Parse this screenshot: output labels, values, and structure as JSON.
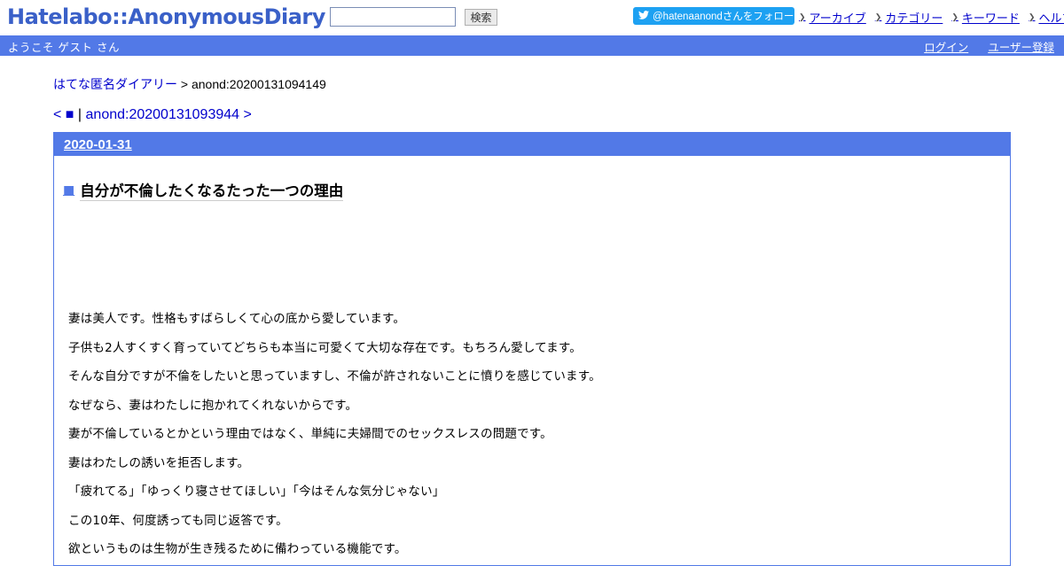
{
  "header": {
    "logo": "Hatelabo::AnonymousDiary",
    "search_value": "",
    "search_button": "検索",
    "follow_label": "@hatenaanondさんをフォロー",
    "nav": [
      "アーカイブ",
      "カテゴリー",
      "キーワード",
      "ヘルプ"
    ]
  },
  "bar": {
    "welcome": "ようこそ ゲスト さん",
    "login": "ログイン",
    "register": "ユーザー登録"
  },
  "breadcrumb": {
    "home": "はてな匿名ダイアリー",
    "separator": ">",
    "current": "anond:20200131094149"
  },
  "pager": {
    "prev": "< ■",
    "separator": "|",
    "next": "anond:20200131093944 >"
  },
  "entry": {
    "date": "2020-01-31",
    "marker": "■",
    "title": "自分が不倫したくなるたった一つの理由",
    "paragraphs": [
      "妻は美人です。性格もすばらしくて心の底から愛しています。",
      "子供も2人すくすく育っていてどちらも本当に可愛くて大切な存在です。もちろん愛してます。",
      "そんな自分ですが不倫をしたいと思っていますし、不倫が許されないことに憤りを感じています。",
      "なぜなら、妻はわたしに抱かれてくれないからです。",
      "妻が不倫しているとかという理由ではなく、単純に夫婦間でのセックスレスの問題です。",
      "妻はわたしの誘いを拒否します。",
      "「疲れてる」「ゆっくり寝させてほしい」「今はそんな気分じゃない」",
      "この10年、何度誘っても同じ返答です。",
      "欲というものは生物が生き残るために備わっている機能です。"
    ]
  },
  "colors": {
    "accent": "#5279e7",
    "link": "#0000cc",
    "twitter": "#1da1f2"
  }
}
